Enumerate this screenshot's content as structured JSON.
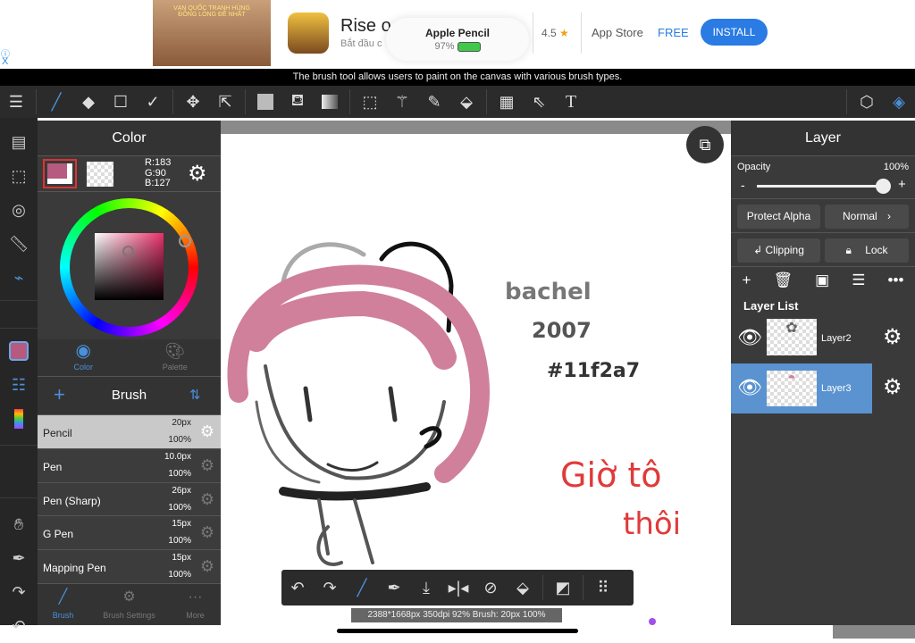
{
  "ad": {
    "title": "Rise o",
    "subtitle": "Bắt đầu c",
    "banner_text": "VẠN QUỐC TRANH HÙNG ĐỒNG LÒNG ĐỀ NHẤT",
    "rating": "4.5",
    "store": "App Store",
    "price": "FREE",
    "install": "INSTALL",
    "info_icon": "info-icon",
    "close": "X"
  },
  "pencil_popup": {
    "title": "Apple Pencil",
    "battery": "97%"
  },
  "tip": "The brush tool allows users to paint on the canvas with various brush types.",
  "color_panel": {
    "title": "Color",
    "r": "R:183",
    "g": "G:90",
    "b": "B:127",
    "main_color": "#b75a7f",
    "tabs": [
      "Color",
      "Palette"
    ]
  },
  "brush_panel": {
    "title": "Brush",
    "items": [
      {
        "name": "Pencil",
        "size": "20px",
        "opacity": "100%"
      },
      {
        "name": "Pen",
        "size": "10.0px",
        "opacity": "100%"
      },
      {
        "name": "Pen (Sharp)",
        "size": "26px",
        "opacity": "100%"
      },
      {
        "name": "G Pen",
        "size": "15px",
        "opacity": "100%"
      },
      {
        "name": "Mapping Pen",
        "size": "15px",
        "opacity": "100%"
      }
    ],
    "tabs": [
      "Brush",
      "Brush Settings",
      "More"
    ]
  },
  "layer_panel": {
    "title": "Layer",
    "opacity_label": "Opacity",
    "opacity_value": "100%",
    "opacity": 100,
    "protect_alpha": "Protect Alpha",
    "blend": "Normal",
    "clipping": "Clipping",
    "lock": "Lock",
    "list_title": "Layer List",
    "layers": [
      {
        "name": "Layer2"
      },
      {
        "name": "Layer3"
      }
    ]
  },
  "canvas": {
    "handwriting1": "bachel",
    "handwriting2": "2007",
    "handwriting3": "#11f2a7",
    "handwriting4": "Giờ tô",
    "handwriting5": "thôi"
  },
  "status": "2388*1668px 350dpi 92% Brush: 20px 100%",
  "accent": "#4a90d9"
}
